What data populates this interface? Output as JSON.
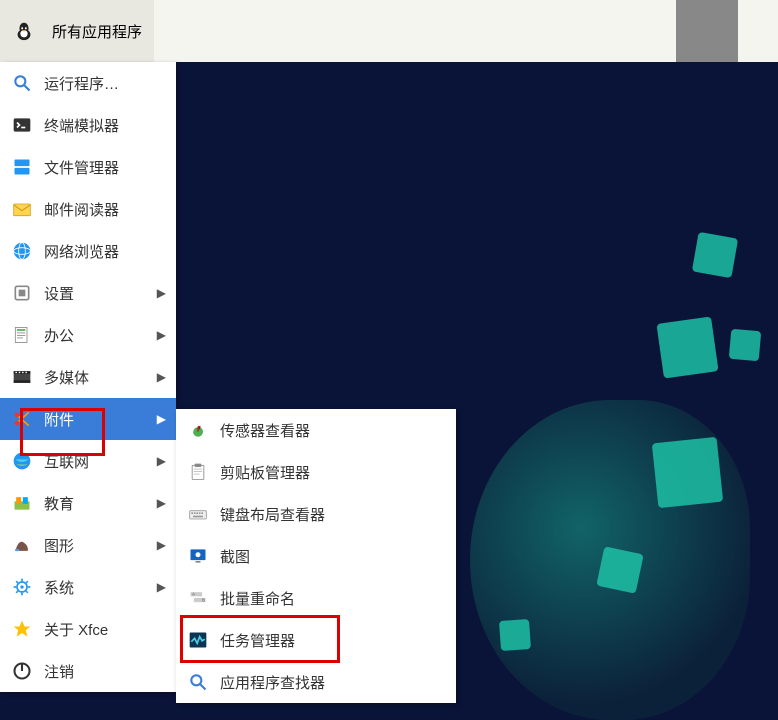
{
  "titlebar": {
    "app_button_label": "所有应用程序"
  },
  "main_menu": [
    {
      "id": "run",
      "label": "运行程序…",
      "icon": "search-icon",
      "has_submenu": false
    },
    {
      "id": "terminal",
      "label": "终端模拟器",
      "icon": "terminal-icon",
      "has_submenu": false
    },
    {
      "id": "filemanager",
      "label": "文件管理器",
      "icon": "folder-icon",
      "has_submenu": false
    },
    {
      "id": "mail",
      "label": "邮件阅读器",
      "icon": "mail-icon",
      "has_submenu": false
    },
    {
      "id": "browser",
      "label": "网络浏览器",
      "icon": "globe-icon",
      "has_submenu": false
    },
    {
      "id": "settings",
      "label": "设置",
      "icon": "settings-icon",
      "has_submenu": true
    },
    {
      "id": "office",
      "label": "办公",
      "icon": "office-icon",
      "has_submenu": true
    },
    {
      "id": "multimedia",
      "label": "多媒体",
      "icon": "multimedia-icon",
      "has_submenu": true
    },
    {
      "id": "accessories",
      "label": "附件",
      "icon": "scissors-icon",
      "has_submenu": true,
      "selected": true
    },
    {
      "id": "internet",
      "label": "互联网",
      "icon": "internet-icon",
      "has_submenu": true
    },
    {
      "id": "education",
      "label": "教育",
      "icon": "education-icon",
      "has_submenu": true
    },
    {
      "id": "graphics",
      "label": "图形",
      "icon": "graphics-icon",
      "has_submenu": true
    },
    {
      "id": "system",
      "label": "系统",
      "icon": "gear-icon",
      "has_submenu": true
    },
    {
      "id": "about",
      "label": "关于 Xfce",
      "icon": "star-icon",
      "has_submenu": false
    },
    {
      "id": "logout",
      "label": "注销",
      "icon": "logout-icon",
      "has_submenu": false
    }
  ],
  "submenu": [
    {
      "id": "sensor-viewer",
      "label": "传感器查看器",
      "icon": "sensor-icon"
    },
    {
      "id": "clipboard-manager",
      "label": "剪贴板管理器",
      "icon": "clipboard-icon"
    },
    {
      "id": "keyboard-layout",
      "label": "键盘布局查看器",
      "icon": "keyboard-icon"
    },
    {
      "id": "screenshot",
      "label": "截图",
      "icon": "screenshot-icon"
    },
    {
      "id": "bulk-rename",
      "label": "批量重命名",
      "icon": "rename-icon"
    },
    {
      "id": "task-manager",
      "label": "任务管理器",
      "icon": "activity-icon"
    },
    {
      "id": "app-finder",
      "label": "应用程序查找器",
      "icon": "search-icon"
    }
  ]
}
